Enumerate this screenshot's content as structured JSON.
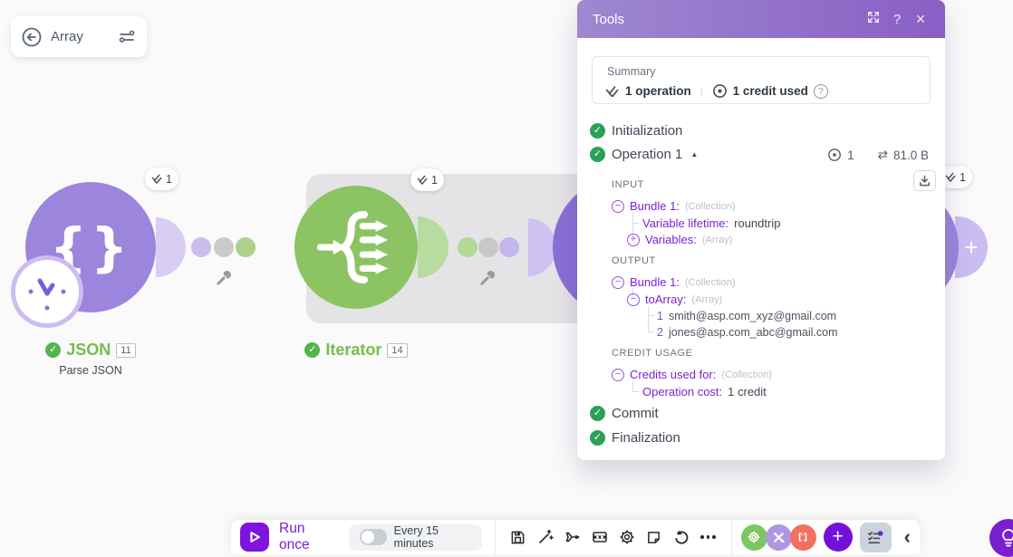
{
  "header_card": {
    "label": "Array"
  },
  "panel": {
    "title": "Tools",
    "summary": {
      "label": "Summary",
      "operations": "1 operation",
      "credits": "1 credit used"
    },
    "rows": {
      "initialization": "Initialization",
      "operation": "Operation 1",
      "commit": "Commit",
      "finalization": "Finalization"
    },
    "operation_meta": {
      "count": "1",
      "size": "81.0 B"
    },
    "input": {
      "label": "INPUT",
      "bundle_label": "Bundle 1:",
      "bundle_type": "(Collection)",
      "lifetime_label": "Variable lifetime:",
      "lifetime_value": "roundtrip",
      "variables_label": "Variables:",
      "variables_type": "(Array)"
    },
    "output": {
      "label": "OUTPUT",
      "bundle_label": "Bundle 1:",
      "bundle_type": "(Collection)",
      "array_label": "toArray:",
      "array_type": "(Array)",
      "items": [
        {
          "index": "1",
          "value": "smith@asp.com_xyz@gmail.com"
        },
        {
          "index": "2",
          "value": "jones@asp.com_abc@gmail.com"
        }
      ]
    },
    "credit": {
      "label": "CREDIT USAGE",
      "used_label": "Credits used for:",
      "used_type": "(Collection)",
      "cost_label": "Operation cost:",
      "cost_value": "1 credit"
    }
  },
  "modules": {
    "json": {
      "name": "JSON",
      "id": "11",
      "subtitle": "Parse JSON",
      "badge": "1"
    },
    "iterator": {
      "name": "Iterator",
      "id": "14",
      "badge": "1"
    },
    "hidden_right": {
      "badge": "1"
    }
  },
  "toolbar": {
    "run_once_label": "Run once",
    "schedule_label": "Every 15 minutes"
  },
  "icons": {
    "question": "?",
    "close": "×",
    "check": "✓",
    "caret_up": "▲",
    "transfer": "⇄",
    "divider": "|",
    "minus": "−",
    "plus": "+",
    "braces": "{}",
    "chevron_left": "‹"
  },
  "colors": {
    "accent_purple": "#7a1fd0",
    "panel_header_start": "#9e88d1",
    "panel_header_end": "#8a5fc5",
    "module_purple": "#9c85dd",
    "module_green": "#8cc464",
    "success_green": "#2aa255",
    "label_purple": "#7d22d4",
    "toolbar_green": "#7cc75f",
    "toolbar_lavender": "#ad97e3",
    "toolbar_red": "#f2705e"
  }
}
